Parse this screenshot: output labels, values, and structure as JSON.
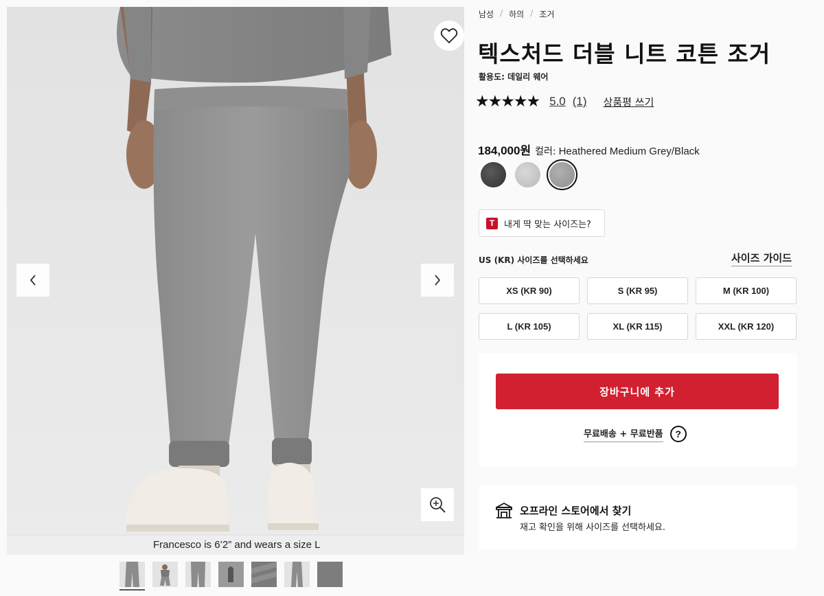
{
  "gallery": {
    "caption": "Francesco is 6’2” and wears a size L",
    "prev_icon": "chevron-left-icon",
    "next_icon": "chevron-right-icon",
    "favorite_icon": "heart-icon",
    "zoom_icon": "zoom-in-icon",
    "thumbnail_count": 7,
    "active_thumbnail": 0
  },
  "breadcrumb": [
    "남성",
    "하의",
    "조거"
  ],
  "product": {
    "title": "텍스처드 더블 니트 코튼 조거",
    "activity": "활용도: 데일리 웨어",
    "stars": "★★★★★",
    "rating_score": "5.0",
    "rating_count": "(1)",
    "review_link": "상품평 쓰기",
    "price": "184,000원",
    "color_label": "컬러:",
    "color_value": "Heathered Medium Grey/Black",
    "colors": [
      {
        "name": "dark-grey",
        "hex": "#3a3a3a"
      },
      {
        "name": "light-grey",
        "hex": "#c8c8c8"
      },
      {
        "name": "medium-grey",
        "hex": "#9c9c9c",
        "selected": true
      }
    ]
  },
  "fit": {
    "badge": "T",
    "label": "내게 딱 맞는 사이즈는?"
  },
  "sizes": {
    "heading": "US (KR) 사이즈를 선택하세요",
    "guide_label": "사이즈 가이드",
    "options": [
      "XS (KR 90)",
      "S (KR 95)",
      "M (KR 100)",
      "L (KR 105)",
      "XL (KR 115)",
      "XXL (KR 120)"
    ]
  },
  "cart": {
    "add_label": "장바구니에 추가",
    "shipping_label": "무료배송 + 무료반품",
    "help_icon": "?"
  },
  "store": {
    "title": "오프라인 스토어에서 찾기",
    "subtitle": "재고 확인을 위해 사이즈를 선택하세요."
  },
  "colors": {
    "accent_red": "#d22030",
    "badge_red": "#c8102e"
  }
}
